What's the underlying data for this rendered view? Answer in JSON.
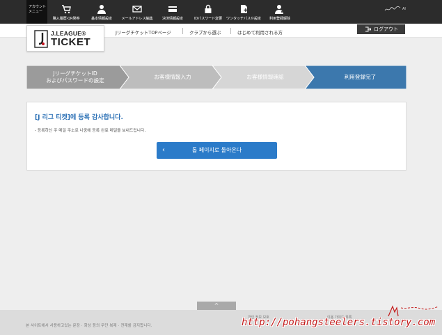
{
  "topbar": {
    "account_label": "アカウントメニュー",
    "items": [
      {
        "label": "購入履歴·QR発券",
        "icon": "cart-icon"
      },
      {
        "label": "基本情報設定",
        "icon": "user-icon"
      },
      {
        "label": "メールアドレス編集",
        "icon": "mail-icon"
      },
      {
        "label": "決済情報設定",
        "icon": "card-icon"
      },
      {
        "label": "IDパスワード変更",
        "icon": "lock-icon"
      },
      {
        "label": "ワンタッチパス©設定",
        "icon": "document-plus-icon"
      },
      {
        "label": "利用登録解除",
        "icon": "user-remove-icon"
      }
    ],
    "right_text": "AI"
  },
  "header": {
    "logo_line1": "J.LEAGUE®",
    "logo_line2": "TICKET",
    "links": [
      "JリーグチケットTOPページ",
      "クラブから選ぶ",
      "はじめて利用される方"
    ],
    "logout_label": "ログアウト"
  },
  "steps": [
    {
      "label": "JリーグチケットID\nおよびパスワードの設定",
      "color": "#9b9b9b"
    },
    {
      "label": "お客様情報入力",
      "color": "#bdbdbd"
    },
    {
      "label": "お客様情報確認",
      "color": "#d6d6d6"
    },
    {
      "label": "利用登録完了",
      "color": "#3c78ad"
    }
  ],
  "main": {
    "title": "[J 리그 티켓]에 등록 감사합니다.",
    "note": "- 등록하신 주 메일 주소로 나중에 등록 완료 메일을 보내드립니다.",
    "back_button_label": "톱 페이지로 돌아온다"
  },
  "footer": {
    "page_top_symbol": "^",
    "copyright": "본 사이트에서 사용하고있는 문장 · 화상 등의 무단 복제 · 전재를 금지합니다.",
    "link1": "개인 정보 보호",
    "link2": "이용 가이드 목록",
    "watermark": "http://pohangsteelers.tistory.com"
  }
}
